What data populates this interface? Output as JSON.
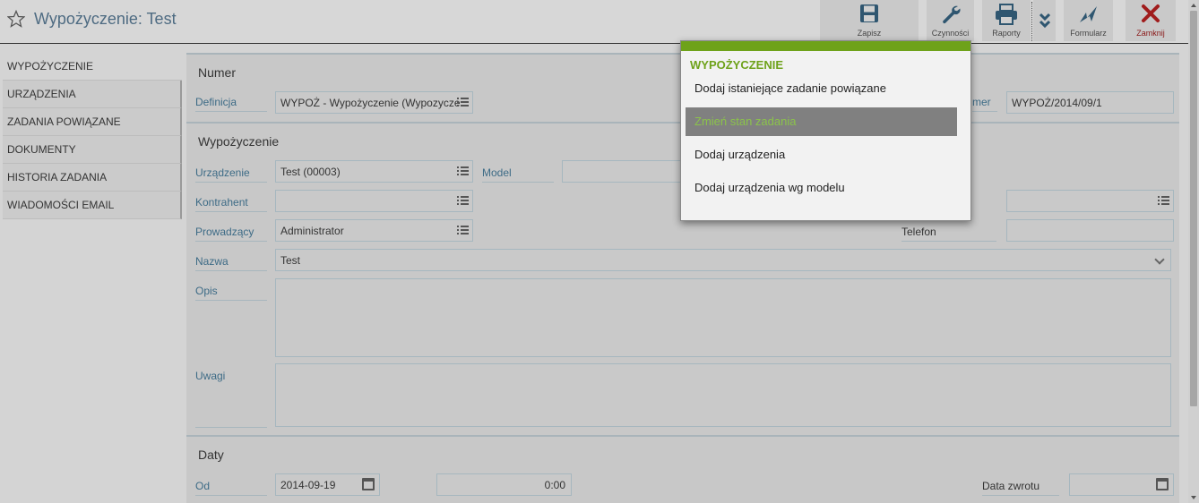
{
  "header": {
    "title": "Wypożyczenie: Test",
    "buttons": {
      "save": "Zapisz",
      "actions": "Czynności",
      "reports": "Raporty",
      "form": "Formularz",
      "close": "Zamknij"
    }
  },
  "sidebar": {
    "items": [
      {
        "label": "WYPOŻYCZENIE"
      },
      {
        "label": "URZĄDZENIA"
      },
      {
        "label": "ZADANIA POWIĄZANE"
      },
      {
        "label": "DOKUMENTY"
      },
      {
        "label": "HISTORIA ZADANIA"
      },
      {
        "label": "WIADOMOŚCI EMAIL"
      }
    ]
  },
  "numer": {
    "title": "Numer",
    "definicja_label": "Definicja",
    "definicja_value": "WYPOŻ - Wypożyczenie (Wypozycze",
    "numer_label": "mer",
    "numer_value": "WYPOŻ/2014/09/1"
  },
  "wypozyczenie": {
    "title": "Wypożyczenie",
    "urzadzenie_label": "Urządzenie",
    "urzadzenie_value": "Test (00003)",
    "model_label": "Model",
    "kontrahent_label": "Kontrahent",
    "kontrahent_value": "",
    "prowadzacy_label": "Prowadzący",
    "prowadzacy_value": "Administrator",
    "telefon_label": "Telefon",
    "nazwa_label": "Nazwa",
    "nazwa_value": "Test",
    "opis_label": "Opis",
    "uwagi_label": "Uwagi"
  },
  "daty": {
    "title": "Daty",
    "od_label": "Od",
    "od_date": "2014-09-19",
    "od_time": "0:00",
    "zwrot_label": "Data zwrotu",
    "zwrot_value": ""
  },
  "popup": {
    "title": "WYPOŻYCZENIE",
    "items": [
      {
        "label": "Dodaj istaniejące zadanie powiązane"
      },
      {
        "label": "Zmień stan zadania"
      },
      {
        "label": "Dodaj urządzenia"
      },
      {
        "label": "Dodaj urządzenia wg modelu"
      }
    ],
    "highlighted_index": 1
  },
  "colors": {
    "accent": "#6ea21a",
    "label": "#3d6b86",
    "close": "#a01c1c"
  }
}
